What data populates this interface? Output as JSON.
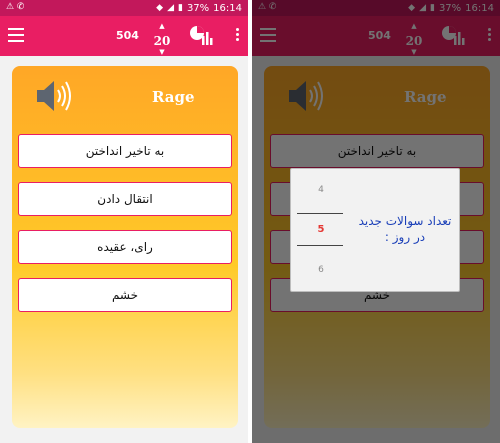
{
  "status_bar": {
    "battery": "37%",
    "time": "16:14"
  },
  "appbar": {
    "count": "504",
    "level": "20"
  },
  "card": {
    "word": "Rage",
    "options": [
      "به تاخیر انداختن",
      "انتقال دادن",
      "رای، عقیده",
      "خشم"
    ]
  },
  "dialog": {
    "picker": {
      "prev": "4",
      "selected": "5",
      "next": "6"
    },
    "text": "تعداد سوالات جدید در روز :"
  },
  "colors": {
    "status_bar": "#c2185b",
    "appbar": "#e91e63",
    "card_top": "#ffa726",
    "card_bottom": "#fff3c4",
    "option_border": "#e91e63",
    "dialog_text": "#1a3fb8",
    "picker_selected": "#e53935"
  }
}
